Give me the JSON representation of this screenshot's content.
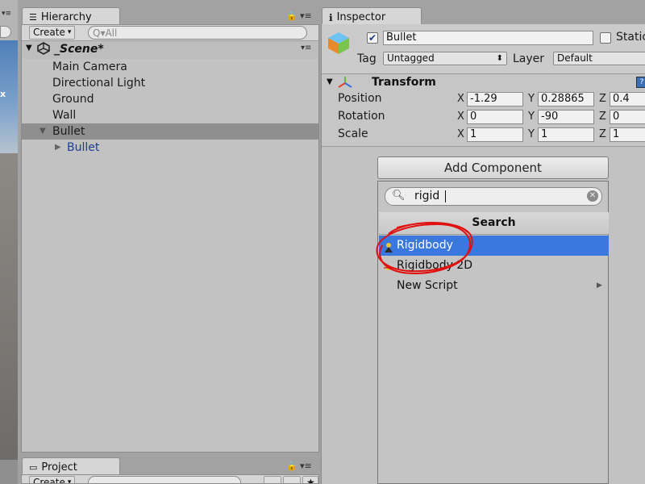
{
  "hierarchy": {
    "tab_label": "Hierarchy",
    "create_label": "Create",
    "search_placeholder": "Q▾All",
    "scene_name": "_Scene*",
    "items": [
      {
        "label": "Main Camera"
      },
      {
        "label": "Directional Light"
      },
      {
        "label": "Ground"
      },
      {
        "label": "Wall"
      },
      {
        "label": "Bullet"
      },
      {
        "label": "Bullet"
      }
    ]
  },
  "project": {
    "tab_label": "Project",
    "create_label": "Create"
  },
  "inspector": {
    "tab_label": "Inspector",
    "object_name": "Bullet",
    "active_checked": true,
    "static_label": "Static",
    "tag_label": "Tag",
    "tag_value": "Untagged",
    "layer_label": "Layer",
    "layer_value": "Default",
    "transform": {
      "title": "Transform",
      "rows": [
        {
          "label": "Position",
          "x": "-1.29",
          "y": "0.28865",
          "z": "0.4"
        },
        {
          "label": "Rotation",
          "x": "0",
          "y": "-90",
          "z": "0"
        },
        {
          "label": "Scale",
          "x": "1",
          "y": "1",
          "z": "1"
        }
      ],
      "axis_x": "X",
      "axis_y": "Y",
      "axis_z": "Z"
    }
  },
  "add_component": {
    "button_label": "Add Component",
    "search_value": "rigid",
    "header": "Search",
    "results": [
      {
        "label": "Rigidbody",
        "highlighted": true
      },
      {
        "label": "Rigidbody 2D",
        "highlighted": false
      },
      {
        "label": "New Script",
        "has_submenu": true
      }
    ]
  },
  "colors": {
    "selection_blue": "#3a78e0",
    "annotation_red": "#e01010"
  }
}
